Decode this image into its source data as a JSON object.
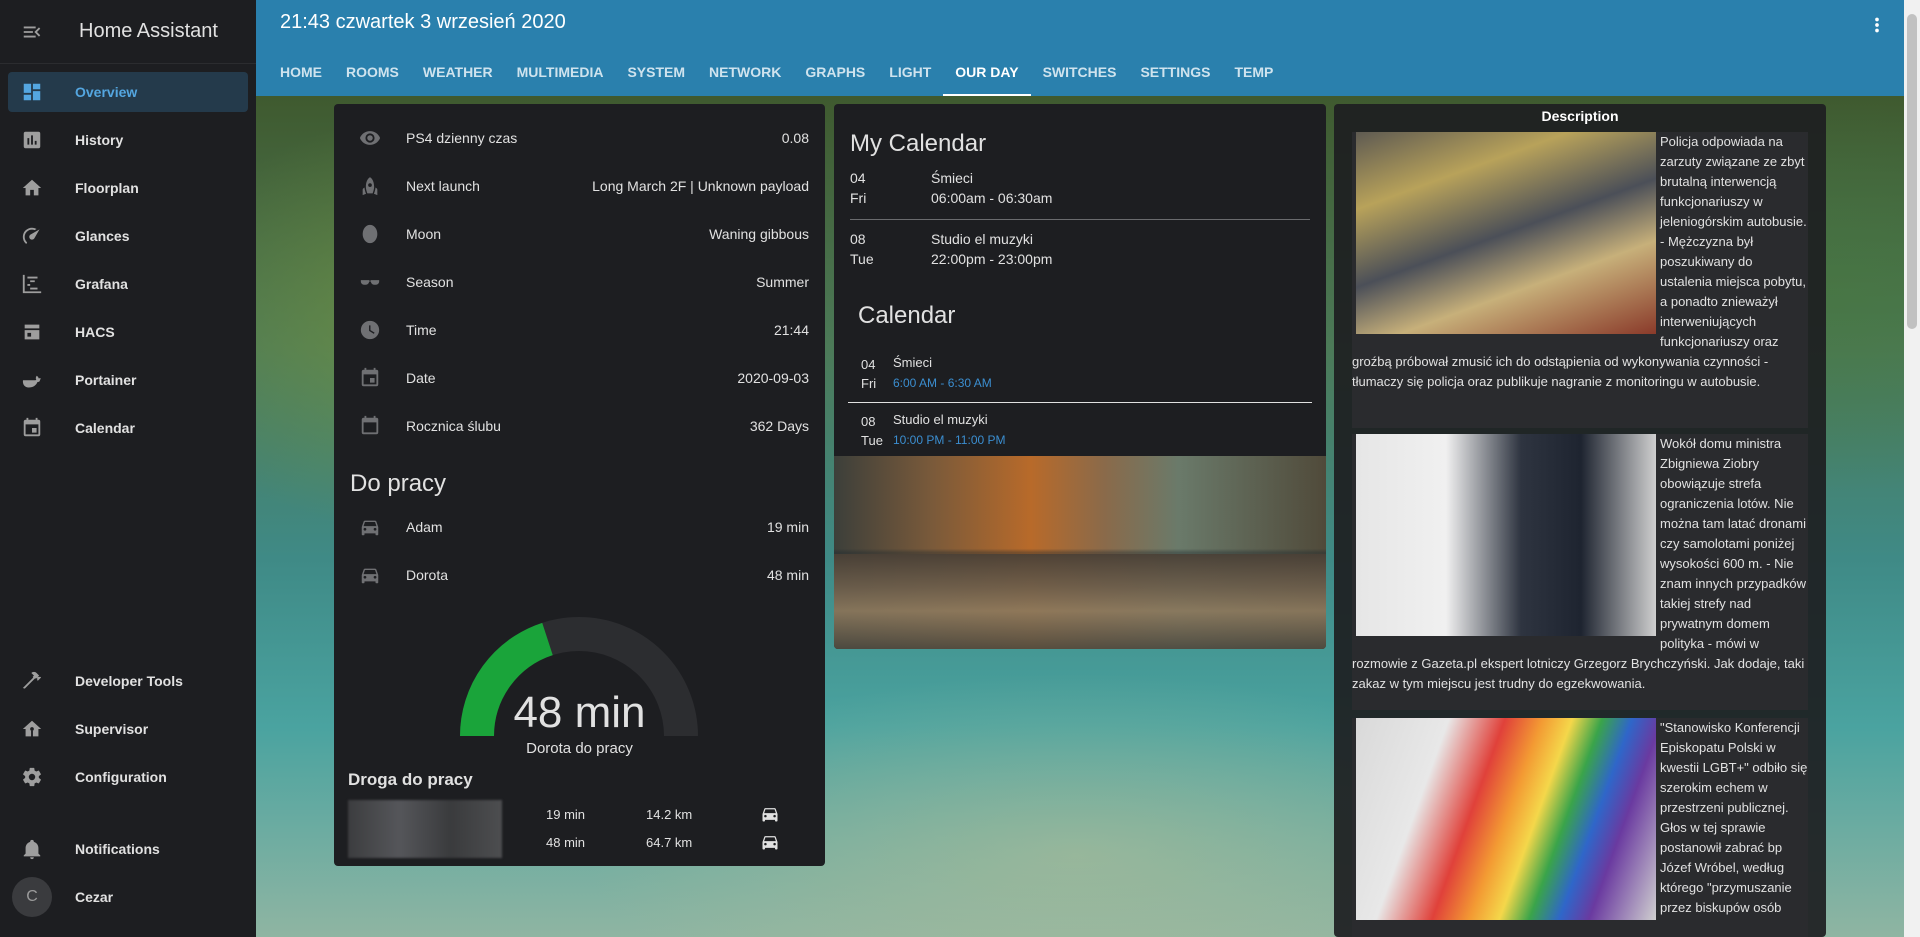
{
  "app_title": "Home Assistant",
  "sidebar": {
    "items": [
      {
        "label": "Overview",
        "icon": "dashboard-icon"
      },
      {
        "label": "History",
        "icon": "chart-bar-icon"
      },
      {
        "label": "Floorplan",
        "icon": "home-icon"
      },
      {
        "label": "Glances",
        "icon": "gauge-icon"
      },
      {
        "label": "Grafana",
        "icon": "chart-timeline-icon"
      },
      {
        "label": "HACS",
        "icon": "hacs-icon"
      },
      {
        "label": "Portainer",
        "icon": "docker-icon"
      },
      {
        "label": "Calendar",
        "icon": "calendar-icon"
      }
    ],
    "bottom": [
      {
        "label": "Developer Tools",
        "icon": "hammer-icon"
      },
      {
        "label": "Supervisor",
        "icon": "supervisor-icon"
      },
      {
        "label": "Configuration",
        "icon": "cog-icon"
      },
      {
        "label": "Notifications",
        "icon": "bell-icon"
      }
    ],
    "user": {
      "initial": "C",
      "name": "Cezar"
    }
  },
  "header": {
    "title": "21:43 czwartek 3 wrzesień 2020",
    "tabs": [
      "HOME",
      "ROOMS",
      "WEATHER",
      "MULTIMEDIA",
      "SYSTEM",
      "NETWORK",
      "GRAPHS",
      "LIGHT",
      "OUR DAY",
      "SWITCHES",
      "SETTINGS",
      "TEMP"
    ],
    "active_tab": "OUR DAY"
  },
  "entities": [
    {
      "name": "PS4 dzienny czas",
      "value": "0.08",
      "icon": "eye-icon"
    },
    {
      "name": "Next launch",
      "value": "Long March 2F | Unknown payload",
      "icon": "rocket-icon"
    },
    {
      "name": "Moon",
      "value": "Waning gibbous",
      "icon": "moon-icon"
    },
    {
      "name": "Season",
      "value": "Summer",
      "icon": "sunglasses-icon"
    },
    {
      "name": "Time",
      "value": "21:44",
      "icon": "clock-icon"
    },
    {
      "name": "Date",
      "value": "2020-09-03",
      "icon": "calendar-icon"
    },
    {
      "name": "Rocznica ślubu",
      "value": "362 Days",
      "icon": "calendar-icon"
    }
  ],
  "commute": {
    "title": "Do pracy",
    "rows": [
      {
        "name": "Adam",
        "value": "19 min",
        "icon": "car-icon"
      },
      {
        "name": "Dorota",
        "value": "48 min",
        "icon": "car-icon"
      }
    ],
    "gauge": {
      "value": "48 min",
      "name": "Dorota do pracy",
      "fraction": 0.4,
      "color": "#1aa43a"
    }
  },
  "route": {
    "title": "Droga do pracy",
    "rows": [
      {
        "time": "19 min",
        "distance": "14.2 km"
      },
      {
        "time": "48 min",
        "distance": "64.7 km"
      }
    ]
  },
  "my_calendar": {
    "title": "My Calendar",
    "events": [
      {
        "day": "04",
        "weekday": "Fri",
        "title": "Śmieci",
        "time": "06:00am - 06:30am"
      },
      {
        "day": "08",
        "weekday": "Tue",
        "title": "Studio el muzyki",
        "time": "22:00pm - 23:00pm"
      }
    ]
  },
  "calendar": {
    "title": "Calendar",
    "events": [
      {
        "day": "04",
        "weekday": "Fri",
        "title": "Śmieci",
        "time": "6:00 AM - 6:30 AM"
      },
      {
        "day": "08",
        "weekday": "Tue",
        "title": "Studio el muzyki",
        "time": "10:00 PM - 11:00 PM"
      }
    ]
  },
  "news": {
    "title": "Description",
    "items": [
      {
        "text": "Policja odpowiada na zarzuty związane ze zbyt brutalną interwencją funkcjonariuszy w jeleniogórskim autobusie. - Mężczyzna był poszukiwany do ustalenia miejsca pobytu, a ponadto znieważył interweniujących funkcjonariuszy oraz groźbą próbował zmusić ich do odstąpienia od wykonywania czynności - tłumaczy się policja oraz publikuje nagranie z monitoringu w autobusie."
      },
      {
        "text": "Wokół domu ministra Zbigniewa Ziobry obowiązuje strefa ograniczenia lotów. Nie można tam latać dronami czy samolotami poniżej wysokości 600 m. - Nie znam innych przypadków takiej strefy nad prywatnym domem polityka - mówi w rozmowie z Gazeta.pl ekspert lotniczy Grzegorz Brychczyński. Jak dodaje, taki zakaz w tym miejscu jest trudny do egzekwowania."
      },
      {
        "text": "\"Stanowisko Konferencji Episkopatu Polski w kwestii LGBT+\" odbiło się szerokim echem w przestrzeni publicznej. Głos w tej sprawie postanowił zabrać bp Józef Wróbel, według którego \"przymuszanie przez biskupów osób"
      }
    ]
  }
}
